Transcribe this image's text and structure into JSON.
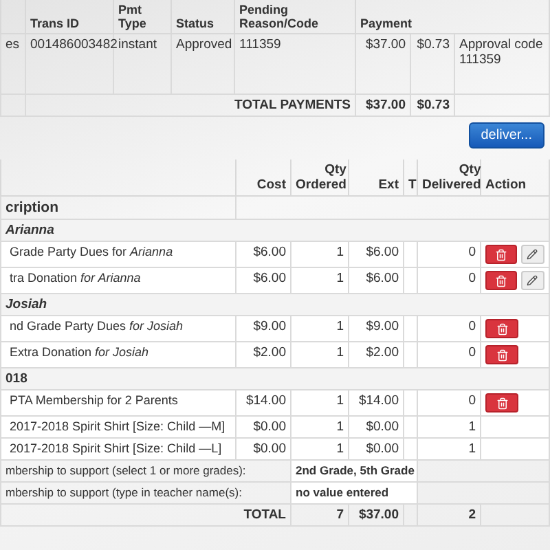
{
  "payments": {
    "left_text": "es",
    "columns": [
      "Trans ID",
      "Pmt Type",
      "Status",
      "Pending Reason/Code",
      "Payment"
    ],
    "rows": [
      {
        "trans_id": "001486003482",
        "pmt_type": "instant",
        "status": "Approved",
        "pending": "111359",
        "amount": "$37.00",
        "fee": "$0.73",
        "note": "Approval code 111359"
      }
    ],
    "total": {
      "label": "TOTAL PAYMENTS",
      "amount": "$37.00",
      "fee": "$0.73"
    },
    "button": "deliver..."
  },
  "orders": {
    "columns": [
      "Cost",
      "Qty Ordered",
      "Ext",
      "T",
      "Qty Delivered",
      "Action"
    ],
    "rows": [
      {
        "kind": "heading",
        "text": "cription"
      },
      {
        "kind": "group",
        "text": "Arianna"
      },
      {
        "kind": "item",
        "text": "Grade Party Dues for *Arianna*",
        "cost": "$6.00",
        "qty": "1",
        "ext": "$6.00",
        "delivered": "0",
        "can_delete": true,
        "can_edit": true
      },
      {
        "kind": "item",
        "text": "tra Donation *for Arianna*",
        "cost": "$6.00",
        "qty": "1",
        "ext": "$6.00",
        "delivered": "0",
        "can_delete": true,
        "can_edit": true
      },
      {
        "kind": "group",
        "text": "Josiah"
      },
      {
        "kind": "item",
        "text": "nd Grade Party Dues *for Josiah*",
        "cost": "$9.00",
        "qty": "1",
        "ext": "$9.00",
        "delivered": "0",
        "can_delete": true,
        "can_edit": false
      },
      {
        "kind": "item",
        "text": "Extra Donation *for Josiah*",
        "cost": "$2.00",
        "qty": "1",
        "ext": "$2.00",
        "delivered": "0",
        "can_delete": true,
        "can_edit": false
      },
      {
        "kind": "group",
        "text": "018"
      },
      {
        "kind": "item",
        "text": "PTA Membership for 2 Parents",
        "cost": "$14.00",
        "qty": "1",
        "ext": "$14.00",
        "delivered": "0",
        "can_delete": true,
        "can_edit": false
      },
      {
        "kind": "item",
        "text": "2017-2018 Spirit Shirt [Size: Child —M]",
        "cost": "$0.00",
        "qty": "1",
        "ext": "$0.00",
        "delivered": "1",
        "can_delete": false,
        "can_edit": false
      },
      {
        "kind": "item",
        "text": "2017-2018 Spirit Shirt [Size: Child —L]",
        "cost": "$0.00",
        "qty": "1",
        "ext": "$0.00",
        "delivered": "1",
        "can_delete": false,
        "can_edit": false
      },
      {
        "kind": "option",
        "text": "mbership to support (select 1 or more grades):",
        "value": "2nd Grade, 5th Grade"
      },
      {
        "kind": "option",
        "text": "mbership to support (type in teacher name(s):",
        "value": "no value entered"
      }
    ],
    "total": {
      "label": "TOTAL",
      "qty": "7",
      "ext": "$37.00",
      "delivered": "2"
    }
  }
}
